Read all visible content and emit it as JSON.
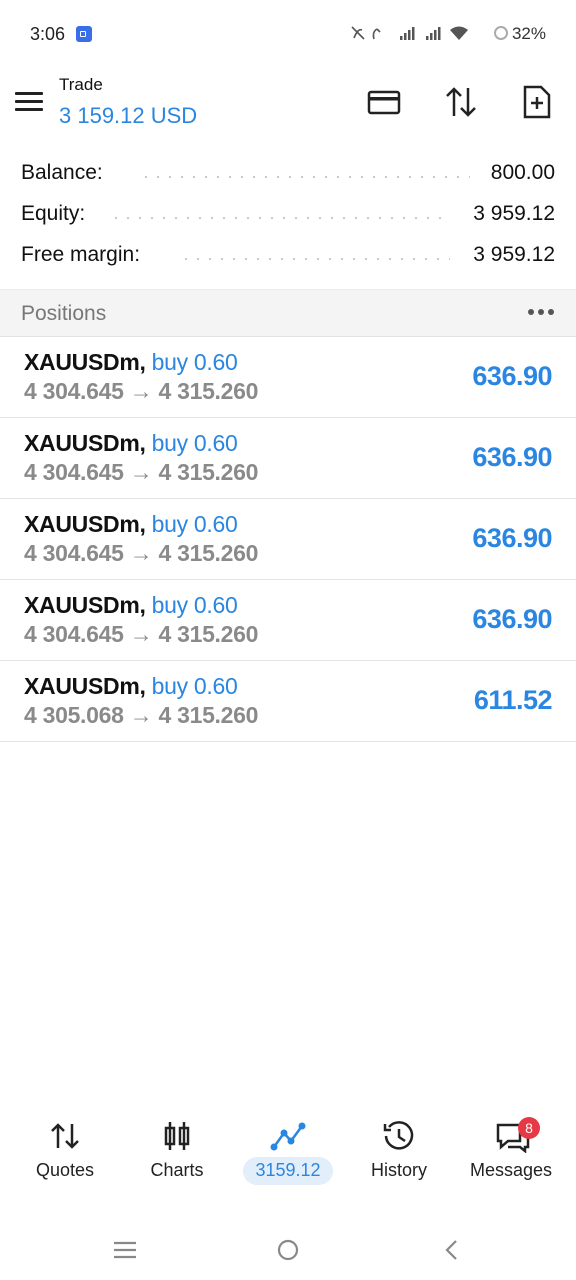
{
  "status_bar": {
    "time": "3:06",
    "network": "4G 4G",
    "battery": "32%"
  },
  "header": {
    "title": "Trade",
    "subtitle": "3 159.12 USD",
    "icons": [
      "menu-icon",
      "card-icon",
      "sort-icon",
      "new-order-icon"
    ]
  },
  "summary": {
    "rows": [
      {
        "label": "Balance:",
        "value": "800.00"
      },
      {
        "label": "Equity:",
        "value": "3 959.12"
      },
      {
        "label": "Free margin:",
        "value": "3 959.12"
      }
    ]
  },
  "positions": {
    "title": "Positions",
    "items": [
      {
        "symbol": "XAUUSDm,",
        "direction": "buy 0.60",
        "prices": "4 304.645 → 4 315.260",
        "profit": "636.90"
      },
      {
        "symbol": "XAUUSDm,",
        "direction": "buy 0.60",
        "prices": "4 304.645 → 4 315.260",
        "profit": "636.90"
      },
      {
        "symbol": "XAUUSDm,",
        "direction": "buy 0.60",
        "prices": "4 304.645 → 4 315.260",
        "profit": "636.90"
      },
      {
        "symbol": "XAUUSDm,",
        "direction": "buy 0.60",
        "prices": "4 304.645 → 4 315.260",
        "profit": "636.90"
      },
      {
        "symbol": "XAUUSDm,",
        "direction": "buy 0.60",
        "prices": "4 305.068 → 4 315.260",
        "profit": "611.52"
      }
    ]
  },
  "bottom_nav": {
    "items": [
      {
        "label": "Quotes",
        "icon": "quotes-icon"
      },
      {
        "label": "Charts",
        "icon": "charts-icon"
      },
      {
        "label": "3159.12",
        "icon": "trade-icon",
        "active": true
      },
      {
        "label": "History",
        "icon": "history-icon"
      },
      {
        "label": "Messages",
        "icon": "messages-icon",
        "badge": "8"
      }
    ]
  },
  "colors": {
    "accent": "#2a86e0",
    "badge": "#e53945"
  }
}
